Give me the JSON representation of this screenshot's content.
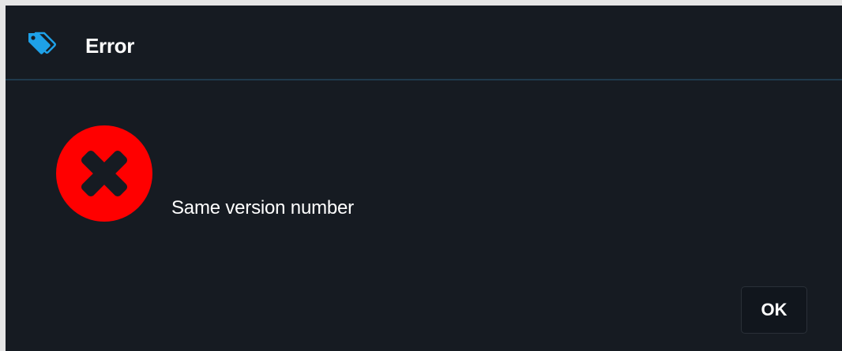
{
  "dialog": {
    "title": "Error",
    "title_icon": "tags-icon",
    "status_icon": "error-x-icon",
    "message": "Same version number",
    "ok_label": "OK"
  },
  "colors": {
    "background": "#161b22",
    "title_divider": "#1f3a4d",
    "icon_accent": "#1ea1e8",
    "error_red": "#ff0000",
    "text": "#ffffff"
  }
}
